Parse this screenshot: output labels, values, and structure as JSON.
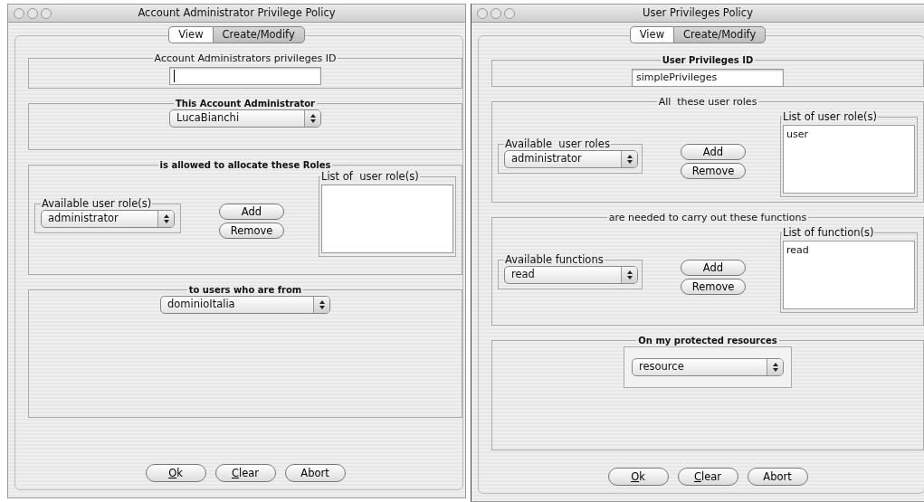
{
  "windows": [
    {
      "title": "Account Administrator Privilege Policy",
      "tabs": [
        {
          "label": "View",
          "selected": false
        },
        {
          "label": "Create/Modify",
          "selected": true
        }
      ],
      "sections": [
        {
          "kind": "field",
          "title": "Account Administrators privileges ID",
          "bold": false,
          "field": {
            "focused": true
          }
        },
        {
          "kind": "select",
          "title": "This Account Administrator",
          "bold": true,
          "framed": false,
          "select": "LucaBianchi"
        },
        {
          "kind": "picker",
          "title": "is allowed to allocate these Roles",
          "bold": true,
          "available": {
            "title": "Available user role(s)",
            "select": "administrator"
          },
          "buttons": [
            "Add",
            "Remove"
          ],
          "list": {
            "title": "List of  user role(s)"
          }
        },
        {
          "kind": "select",
          "title": "to users who are from",
          "bold": true,
          "framed": false,
          "select": "dominioItalia"
        }
      ],
      "buttons": [
        {
          "label": "Ok",
          "underline_first": true
        },
        {
          "label": "Clear",
          "underline_first": true
        },
        {
          "label": "Abort",
          "underline_first": false
        }
      ]
    },
    {
      "title": "User Privileges Policy",
      "tabs": [
        {
          "label": "View",
          "selected": false
        },
        {
          "label": "Create/Modify",
          "selected": true
        }
      ],
      "sections": [
        {
          "kind": "field",
          "title": "User Privileges ID",
          "bold": true,
          "field": {
            "value": "simplePrivileges",
            "focused": false
          }
        },
        {
          "kind": "picker",
          "title": "All  these user roles",
          "bold": false,
          "available": {
            "title": "Available  user roles",
            "select": "administrator"
          },
          "buttons": [
            "Add",
            "Remove"
          ],
          "list": {
            "title": "List of user role(s)",
            "items": [
              "user"
            ]
          }
        },
        {
          "kind": "picker",
          "title": "are needed to carry out these functions",
          "bold": false,
          "available": {
            "title": "Available functions",
            "select": "read"
          },
          "buttons": [
            "Add",
            "Remove"
          ],
          "list": {
            "title": "List of function(s)",
            "items": [
              "read"
            ]
          }
        },
        {
          "kind": "select",
          "title": "On my protected resources",
          "bold": true,
          "framed": true,
          "select": "resource"
        }
      ],
      "buttons": [
        {
          "label": "Ok",
          "underline_first": true
        },
        {
          "label": "Clear",
          "underline_first": true
        },
        {
          "label": "Abort",
          "underline_first": false
        }
      ]
    }
  ]
}
